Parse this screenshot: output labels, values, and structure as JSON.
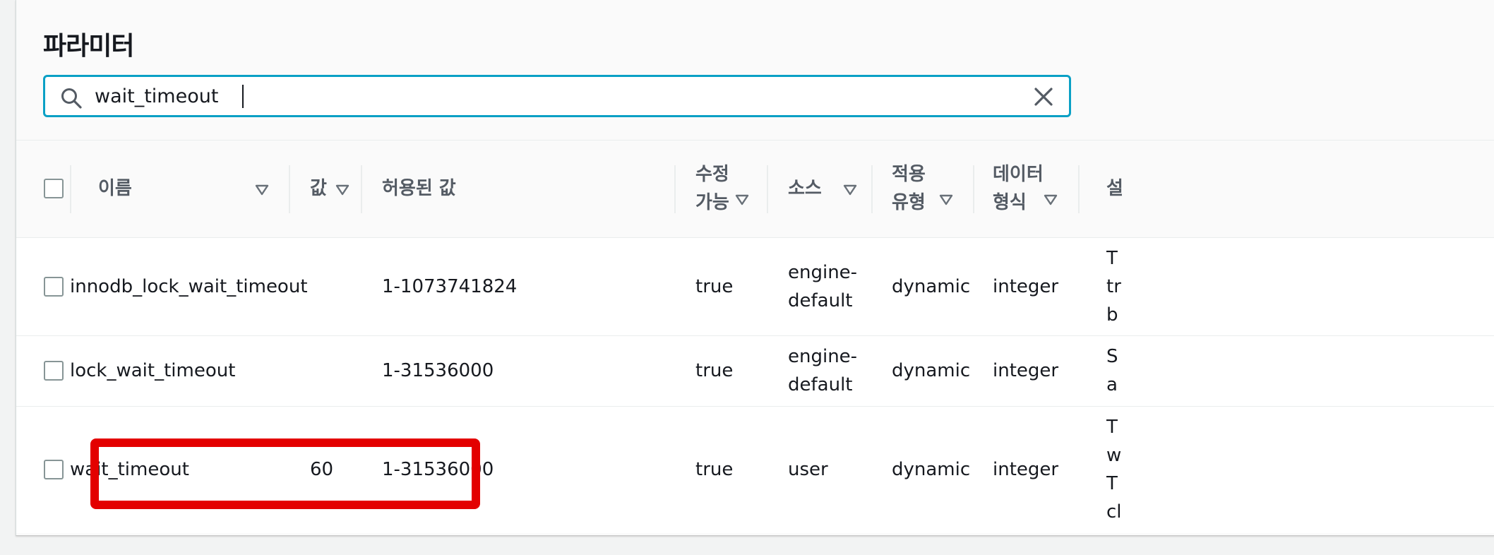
{
  "panel": {
    "title": "파라미터"
  },
  "search": {
    "value": "wait_timeout"
  },
  "table": {
    "columns": {
      "name": "이름",
      "value": "값",
      "allowed_values": "허용된 값",
      "modifiable_line1": "수정",
      "modifiable_line2": "가능",
      "source": "소스",
      "apply_type_line1": "적용",
      "apply_type_line2": "유형",
      "data_type_line1": "데이터",
      "data_type_line2": "형식",
      "description_partial": "설"
    },
    "rows": [
      {
        "name": "innodb_lock_wait_timeout",
        "value": "",
        "allowed_values": "1-1073741824",
        "modifiable": "true",
        "source_line1": "engine-",
        "source_line2": "default",
        "apply_type": "dynamic",
        "data_type": "integer",
        "desc_line1": "T",
        "desc_line2": "tr",
        "desc_line3": "b"
      },
      {
        "name": "lock_wait_timeout",
        "value": "",
        "allowed_values": "1-31536000",
        "modifiable": "true",
        "source_line1": "engine-",
        "source_line2": "default",
        "apply_type": "dynamic",
        "data_type": "integer",
        "desc_line1": "S",
        "desc_line2": "a"
      },
      {
        "name": "wait_timeout",
        "value": "60",
        "allowed_values": "1-31536000",
        "modifiable": "true",
        "source_line1": "user",
        "apply_type": "dynamic",
        "data_type": "integer",
        "desc_line1": "T",
        "desc_line2": "w",
        "desc_line3": "T",
        "desc_line4": "cl"
      }
    ]
  },
  "colors": {
    "search_border": "#0aa0c5",
    "highlight_border": "#e30000",
    "header_text": "#545b64"
  }
}
